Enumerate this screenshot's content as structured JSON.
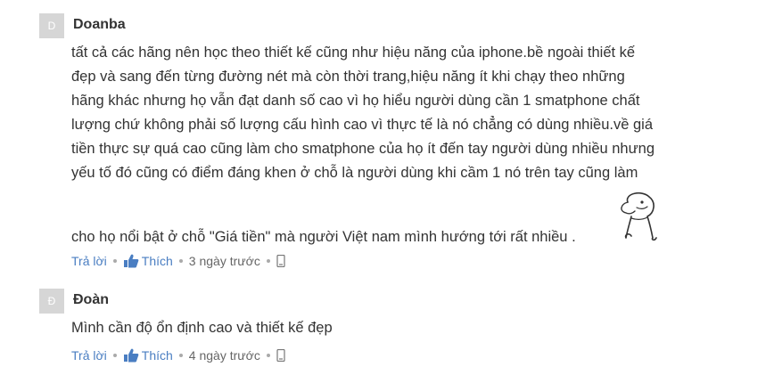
{
  "comments": [
    {
      "avatar_letter": "D",
      "author": "Doanba",
      "lines": [
        "tất cả các hãng nên học theo thiết kế cũng như hiệu năng của iphone.bề ngoài thiết kế",
        "đẹp và sang đến từng đường nét mà còn thời trang,hiệu năng ít khi chạy theo những",
        "hãng khác nhưng họ vẫn đạt danh số cao vì họ hiểu người dùng cần 1 smatphone chất",
        "lượng chứ không phải số lượng cấu hình cao vì thực tế là nó chẳng có dùng nhiều.về giá",
        "tiền thực sự quá cao cũng làm cho smatphone của họ ít đến tay người dùng nhiều nhưng",
        "yếu tố đó cũng có điểm đáng khen ở chỗ là người dùng khi cầm 1 nó trên tay cũng làm",
        "cho họ nổi bật ở chỗ \"Giá tiền\" mà người Việt nam mình hướng tới rất nhiều ."
      ],
      "reply_label": "Trả lời",
      "like_label": "Thích",
      "time": "3 ngày trước",
      "sticker_icon": "doodle-sticker-icon"
    },
    {
      "avatar_letter": "Đ",
      "author": "Đoàn",
      "lines": [
        "Mình cần độ ổn định cao và thiết kế đẹp"
      ],
      "reply_label": "Trả lời",
      "like_label": "Thích",
      "time": "4 ngày trước"
    }
  ],
  "colors": {
    "link": "#4a7ec2",
    "avatar_bg": "#d6d6d6",
    "text": "#333333"
  }
}
